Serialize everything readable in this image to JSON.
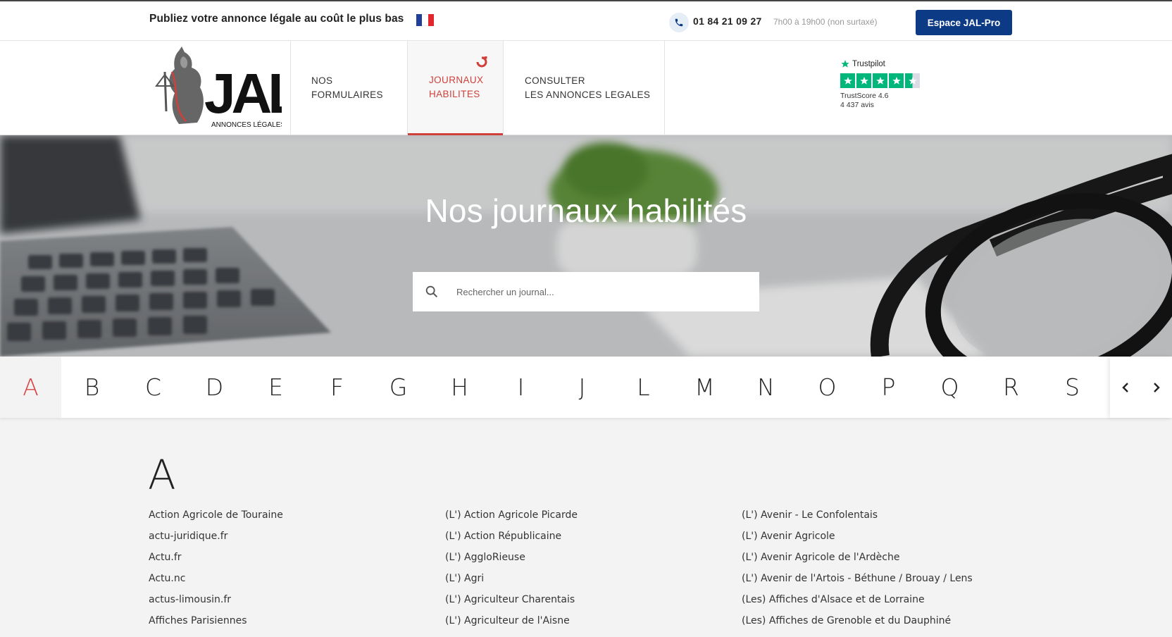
{
  "topbar": {
    "tagline": "Publiez votre annonce légale au coût le plus bas",
    "flag_colors": [
      "#1f3f99",
      "#ffffff",
      "#e1262d"
    ],
    "phone_icon": "phone-icon",
    "phone": "01 84 21 09 27",
    "hours": "7h00 à 19h00 (non surtaxé)",
    "pro_button": "Espace JAL-Pro"
  },
  "logo": {
    "text_main": "JAL",
    "text_sub": "ANNONCES LÉGALES"
  },
  "nav": {
    "items": [
      {
        "line1": "NOS",
        "line2": "FORMULAIRES"
      },
      {
        "line1": "JOURNAUX",
        "line2": "HABILITES",
        "active": true
      },
      {
        "line1": "CONSULTER",
        "line2": "LES ANNONCES LEGALES"
      }
    ],
    "trustpilot": {
      "brand": "Trustpilot",
      "rating_stars": 4.5,
      "score": "TrustScore 4.6",
      "count": "4 437 avis"
    }
  },
  "hero": {
    "title": "Nos journaux habilités",
    "search_placeholder": "Rechercher un journal..."
  },
  "alphabet": {
    "letters": [
      "A",
      "B",
      "C",
      "D",
      "E",
      "F",
      "G",
      "H",
      "I",
      "J",
      "L",
      "M",
      "N",
      "O",
      "P",
      "Q",
      "R",
      "S"
    ],
    "active": "A",
    "prev_icon": "chevron-left-icon",
    "next_icon": "chevron-right-icon"
  },
  "listing": {
    "section_letter": "A",
    "columns": [
      [
        "Action Agricole de Touraine",
        "actu-juridique.fr",
        "Actu.fr",
        "Actu.nc",
        "actus-limousin.fr",
        "Affiches Parisiennes"
      ],
      [
        "(L') Action Agricole Picarde",
        "(L') Action Républicaine",
        "(L') AggloRieuse",
        "(L') Agri",
        "(L') Agriculteur Charentais",
        "(L') Agriculteur de l'Aisne"
      ],
      [
        "(L') Avenir - Le Confolentais",
        "(L') Avenir Agricole",
        "(L') Avenir Agricole de l'Ardèche",
        "(L') Avenir de l'Artois - Béthune / Brouay / Lens",
        "(Les) Affiches d'Alsace et de Lorraine",
        "(Les) Affiches de Grenoble et du Dauphiné"
      ]
    ]
  },
  "colors": {
    "brand_blue": "#0d3a85",
    "accent_red": "#d0403b",
    "trustpilot_green": "#00b67a"
  }
}
